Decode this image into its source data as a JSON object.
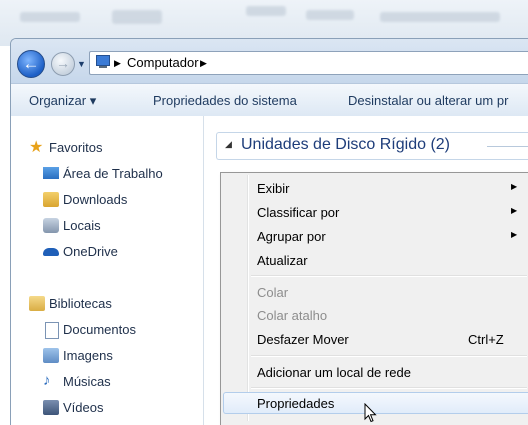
{
  "address": {
    "crumbs": [
      "Computador"
    ],
    "separator": "▶"
  },
  "toolbar": {
    "organize_label": "Organizar ▾",
    "system_properties_label": "Propriedades do sistema",
    "uninstall_label": "Desinstalar ou alterar um pr"
  },
  "nav": {
    "favorites": "Favoritos",
    "desktop": "Área de Trabalho",
    "downloads": "Downloads",
    "places": "Locais",
    "onedrive": "OneDrive",
    "libraries": "Bibliotecas",
    "documents": "Documentos",
    "images": "Imagens",
    "music": "Músicas",
    "videos": "Vídeos"
  },
  "group": {
    "label": "Unidades de Disco Rígido (2)"
  },
  "context_menu": {
    "view": "Exibir",
    "sort_by": "Classificar por",
    "group_by": "Agrupar por",
    "refresh": "Atualizar",
    "paste": "Colar",
    "paste_shortcut": "Colar atalho",
    "undo_move": "Desfazer Mover",
    "undo_shortcut": "Ctrl+Z",
    "add_network_location": "Adicionar um local de rede",
    "properties": "Propriedades"
  },
  "colors": {
    "accent": "#1e3d7a",
    "highlight": "#e1ecfa",
    "disabled": "#8d8d8d"
  }
}
